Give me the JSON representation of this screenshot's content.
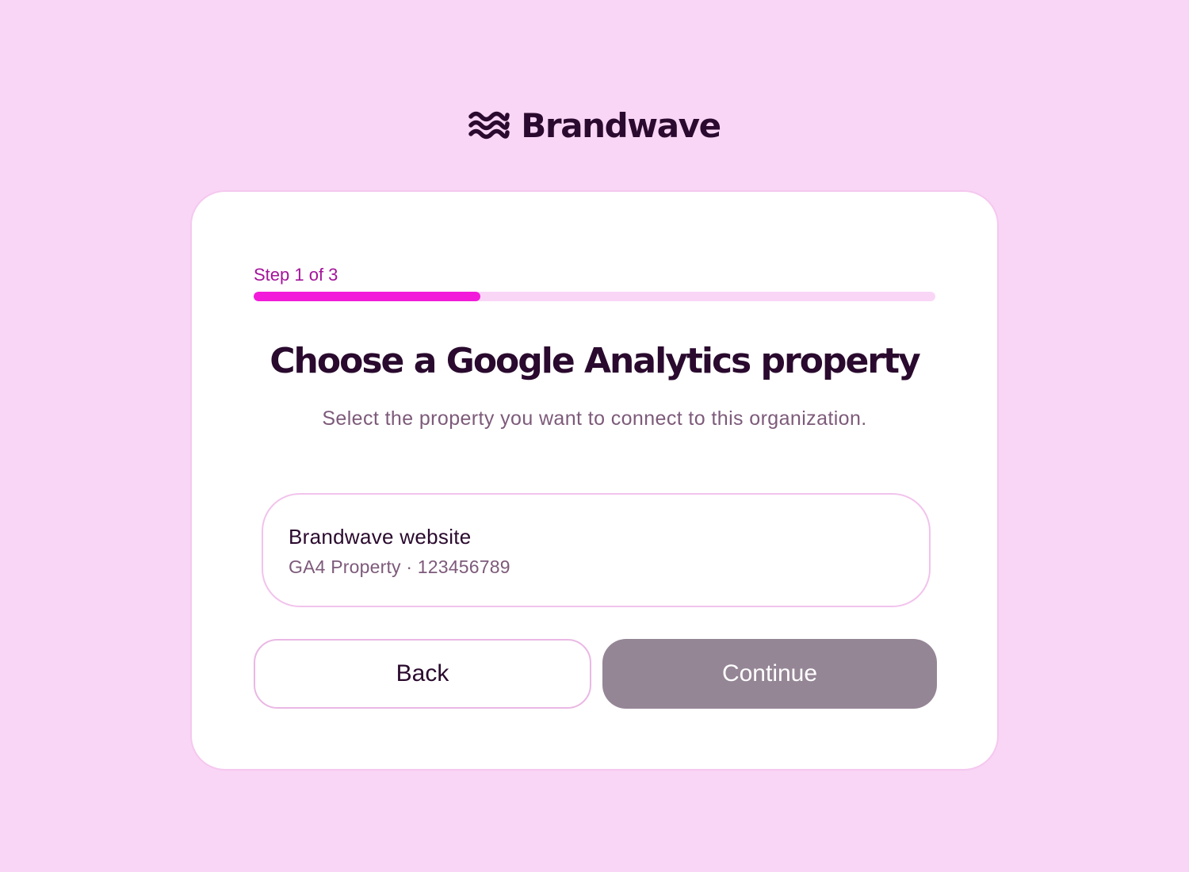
{
  "brand": {
    "logo_icon": "waves-icon",
    "name": "Brandwave"
  },
  "wizard": {
    "step_label": "Step 1 of 3",
    "current_step": 1,
    "total_steps": 3,
    "progress_fraction": 0.333
  },
  "heading": "Choose a Google Analytics property",
  "subtitle": "Select the property you want to connect to this organization.",
  "properties": [
    {
      "name": "Brandwave website",
      "meta": "GA4 Property · 123456789"
    }
  ],
  "actions": {
    "back_label": "Back",
    "continue_label": "Continue",
    "continue_enabled": false
  },
  "colors": {
    "background": "#f9d5f6",
    "accent": "#f21bd9",
    "step_text": "#a3149a",
    "text_dark": "#2a0a2e",
    "text_muted": "#7d5a7a",
    "disabled_button": "#958696"
  }
}
